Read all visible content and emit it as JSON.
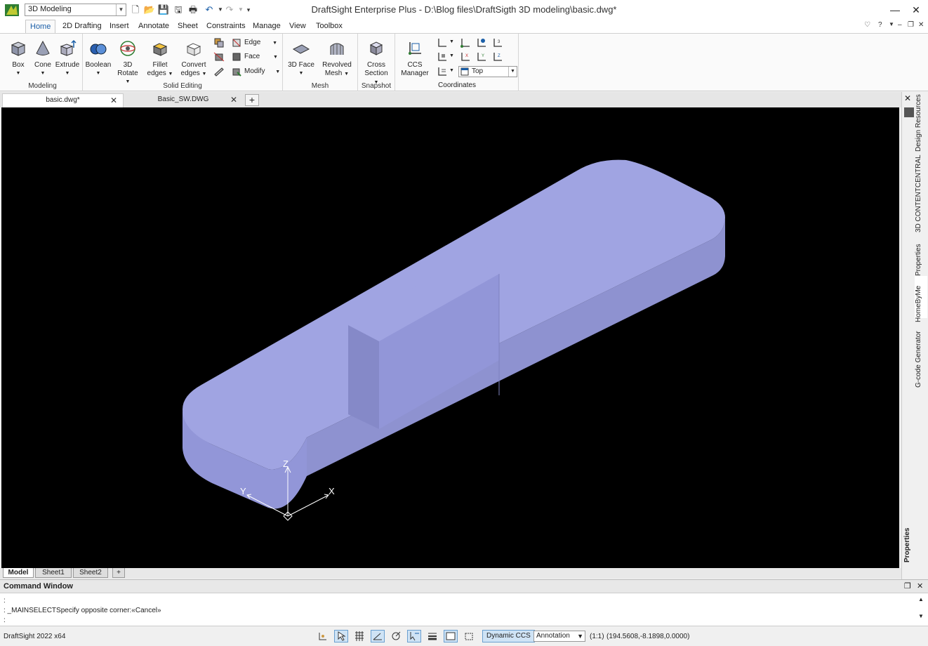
{
  "app": {
    "title": "DraftSight Enterprise Plus - D:\\Blog files\\DraftSigth 3D modeling\\basic.dwg*",
    "workspace": "3D Modeling"
  },
  "ribbon_tabs": [
    "Home",
    "2D Drafting",
    "Insert",
    "Annotate",
    "Sheet",
    "Constraints",
    "Manage",
    "View",
    "Toolbox"
  ],
  "ribbon": {
    "modeling": {
      "label": "Modeling",
      "box": "Box",
      "cone": "Cone",
      "extrude": "Extrude"
    },
    "solid_editing": {
      "label": "Solid Editing",
      "boolean": "Boolean",
      "rotate3d": "3D Rotate",
      "fillet_1": "Fillet",
      "fillet_2": "edges",
      "convert_1": "Convert",
      "convert_2": "edges",
      "edge": "Edge",
      "face": "Face",
      "modify": "Modify"
    },
    "mesh": {
      "label": "Mesh",
      "face3d": "3D Face",
      "revolved_1": "Revolved",
      "revolved_2": "Mesh"
    },
    "snapshot": {
      "label": "Snapshot",
      "cross_1": "Cross",
      "cross_2": "Section"
    },
    "coordinates": {
      "label": "Coordinates",
      "ccs_1": "CCS",
      "ccs_2": "Manager",
      "view": "Top"
    }
  },
  "doc_tabs": [
    "basic.dwg*",
    "Basic_SW.DWG"
  ],
  "side_tabs": [
    "Design Resources",
    "3D CONTENTCENTRAL",
    "Properties",
    "HomeByMe",
    "G-code Generator"
  ],
  "side_properties_label": "Properties",
  "sheet_tabs": [
    "Model",
    "Sheet1",
    "Sheet2"
  ],
  "command_window": {
    "title": "Command Window",
    "line_prefix": ":",
    "last_command": ": _MAINSELECTSpecify opposite corner:«Cancel»",
    "prompt": ":"
  },
  "status": {
    "version": "DraftSight 2022 x64",
    "dynamic_ccs": "Dynamic CCS",
    "annotation": "Annotation",
    "scale": "(1:1)",
    "coords": "(194.5608,-8.1898,0.0000)"
  },
  "ucs_axes": {
    "x": "X",
    "y": "Y",
    "z": "Z"
  },
  "colors": {
    "solid_top": "#a0a4e2",
    "solid_side": "#8e92d0",
    "solid_front": "#9296d8",
    "canvas_bg": "#000000",
    "accent": "#1b5fa8"
  }
}
